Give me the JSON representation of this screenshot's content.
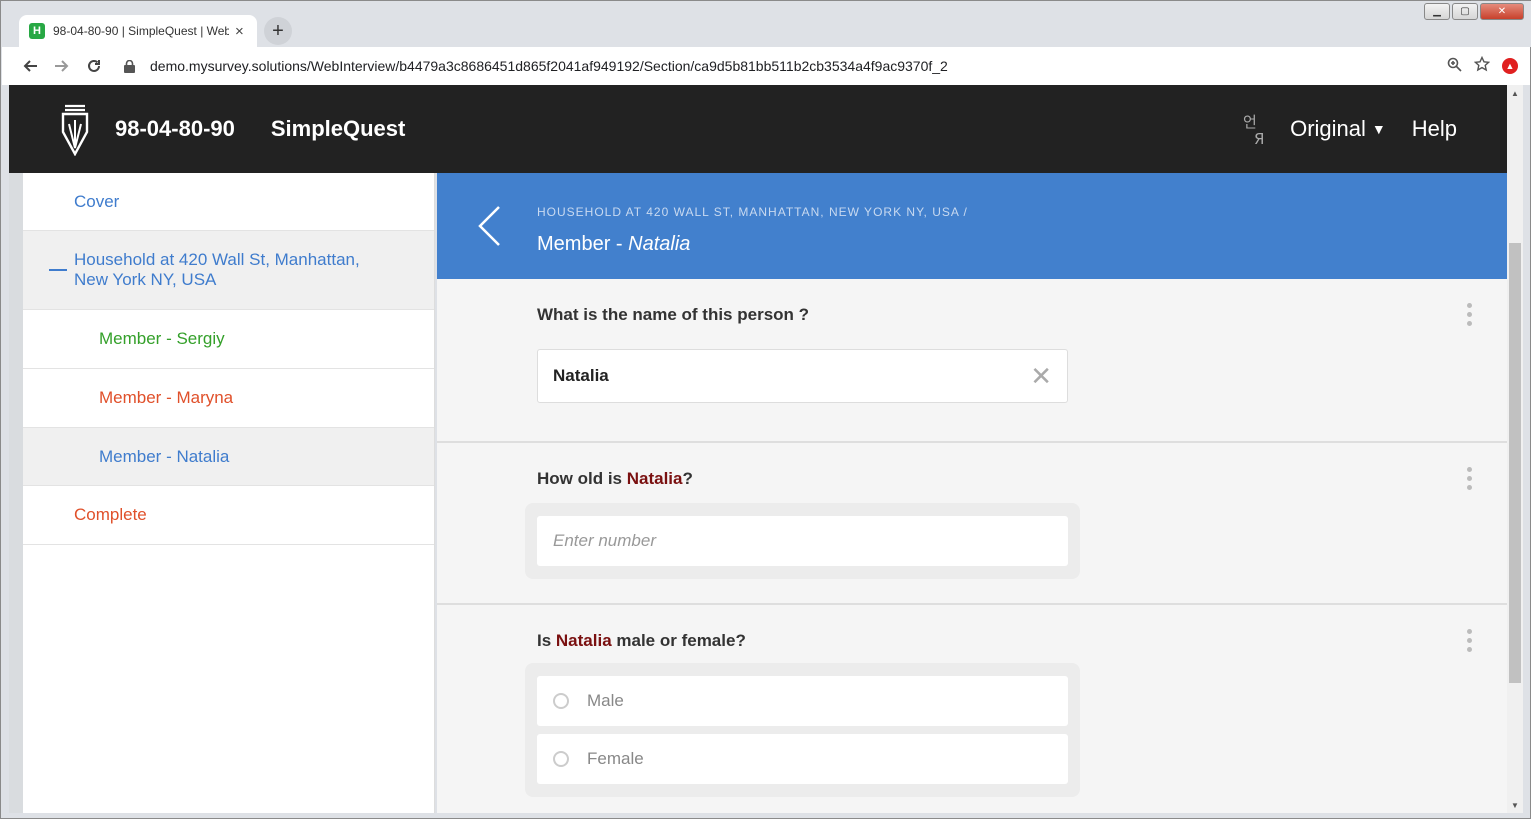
{
  "browser": {
    "tab_title": "98-04-80-90 | SimpleQuest | WebInterview",
    "favicon_letter": "H",
    "new_tab": "+",
    "tab_close": "×",
    "url": "demo.mysurvey.solutions/WebInterview/b4479a3c8686451d865f2041af949192/Section/ca9d5b81bb511b2cb3534a4f9ac9370f_2",
    "window_controls": {
      "minimize": "▁",
      "maximize": "▢",
      "close": "✕"
    }
  },
  "header": {
    "interview_id": "98-04-80-90",
    "questionnaire": "SimpleQuest",
    "language": "Original",
    "language_caret": "▼",
    "help": "Help",
    "translate_glyph": "언 ",
    "logo_icon": "pen-shield-icon"
  },
  "sidebar": {
    "items": [
      {
        "label": "Cover",
        "status": "blue"
      },
      {
        "label": "Household at 420 Wall St, Manhattan, New York NY, USA",
        "status": "blue"
      },
      {
        "label": "Member - Sergiy",
        "status": "green"
      },
      {
        "label": "Member - Maryna",
        "status": "red"
      },
      {
        "label": "Member - Natalia",
        "status": "blue"
      },
      {
        "label": "Complete",
        "status": "red"
      }
    ]
  },
  "section": {
    "breadcrumb": "HOUSEHOLD AT 420 WALL ST, MANHATTAN, NEW YORK NY, USA  /",
    "title_prefix": "Member - ",
    "title_name": "Natalia"
  },
  "questions": {
    "name": {
      "text": "What is the name of this person ?",
      "value": "Natalia",
      "clear": "✕"
    },
    "age": {
      "prefix": "How old is ",
      "sub": "Natalia",
      "suffix": "?",
      "placeholder": "Enter number"
    },
    "sex": {
      "prefix": "Is ",
      "sub": "Natalia",
      "suffix": " male or female?",
      "options": [
        "Male",
        "Female"
      ]
    }
  },
  "colors": {
    "header_bg": "#222222",
    "section_bg": "#4280cd",
    "link_blue": "#3f7ccd",
    "status_green": "#34a02a",
    "status_red": "#e0502a",
    "substitution": "#7a1010"
  }
}
